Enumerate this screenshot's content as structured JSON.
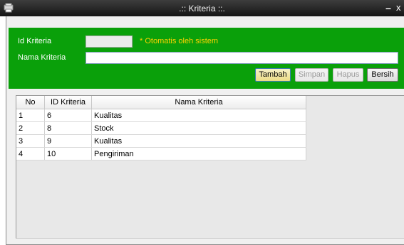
{
  "window": {
    "title": ".:: Kriteria ::.",
    "minimize_glyph": "–",
    "close_glyph": "x"
  },
  "form": {
    "id_label": "Id Kriteria",
    "id_value": "",
    "id_hint": "* Otomatis oleh sistem",
    "name_label": "Nama Kriteria",
    "name_value": ""
  },
  "buttons": {
    "add": "Tambah",
    "save": "Simpan",
    "delete": "Hapus",
    "clear": "Bersih"
  },
  "table": {
    "headers": [
      "No",
      "ID Kriteria",
      "Nama Kriteria"
    ],
    "rows": [
      [
        "1",
        "6",
        "Kualitas"
      ],
      [
        "2",
        "8",
        "Stock"
      ],
      [
        "3",
        "9",
        "Kualitas"
      ],
      [
        "4",
        "10",
        "Pengiriman"
      ]
    ]
  },
  "colors": {
    "panel": "#0aa00a",
    "hint": "#ffd200",
    "titlebar": "#1e1e1e"
  }
}
